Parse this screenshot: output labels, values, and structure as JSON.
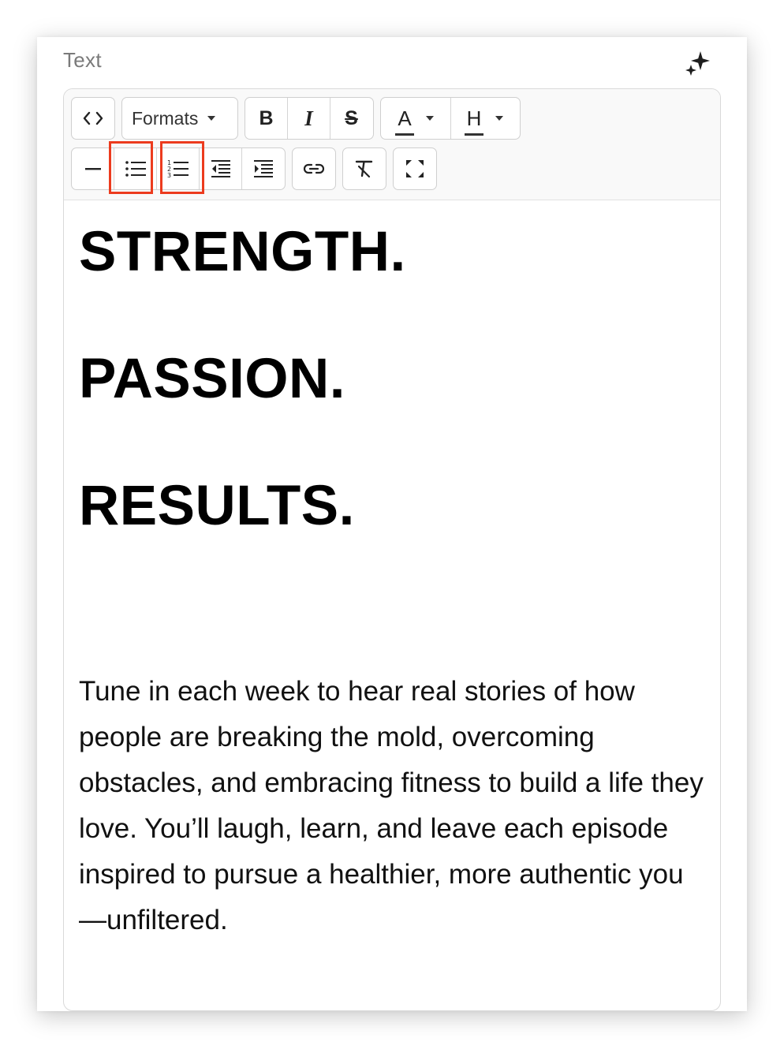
{
  "panel": {
    "title": "Text",
    "ai_icon": "sparkle-icon"
  },
  "toolbar": {
    "row1": {
      "source_code": {
        "icon": "code-icon",
        "label": "<>"
      },
      "formats": {
        "label": "Formats",
        "icon": "chevron-down-icon"
      },
      "bold": {
        "label": "B",
        "icon": "bold-icon"
      },
      "italic": {
        "label": "I",
        "icon": "italic-icon"
      },
      "strikethrough": {
        "label": "S",
        "icon": "strikethrough-icon"
      },
      "text_color": {
        "label": "A",
        "icon": "chevron-down-icon"
      },
      "highlight_color": {
        "label": "H",
        "icon": "chevron-down-icon"
      }
    },
    "row2": {
      "horizontal_rule": {
        "icon": "horizontal-rule-icon"
      },
      "bullet_list": {
        "icon": "bullet-list-icon",
        "highlighted": true
      },
      "numbered_list": {
        "icon": "numbered-list-icon",
        "highlighted": true
      },
      "outdent": {
        "icon": "outdent-icon"
      },
      "indent": {
        "icon": "indent-icon"
      },
      "link": {
        "icon": "link-icon"
      },
      "clear_formatting": {
        "icon": "clear-formatting-icon"
      },
      "fullscreen": {
        "icon": "fullscreen-icon"
      }
    },
    "highlight_color": "#ec3b1e"
  },
  "content": {
    "headings": [
      "STRENGTH.",
      "PASSION.",
      "RESULTS."
    ],
    "paragraph": "Tune in each week to hear real stories of how people are breaking the mold, overcoming obstacles, and embracing fitness to build a life they love. You’ll laugh, learn, and leave each episode inspired to pursue a healthier, more authentic you—unfiltered."
  }
}
